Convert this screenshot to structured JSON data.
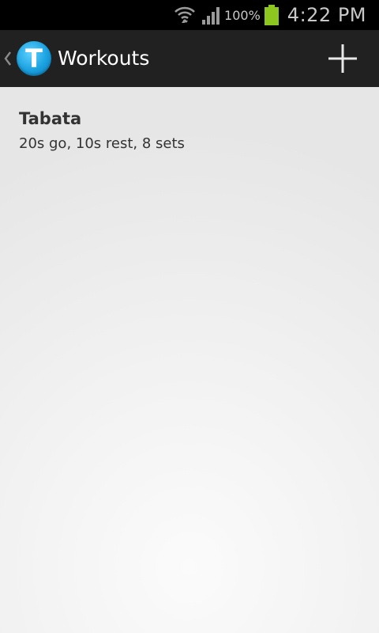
{
  "status_bar": {
    "wifi_icon": "wifi-icon",
    "signal_icon": "signal-icon",
    "battery_percent": "100%",
    "battery_icon": "battery-icon",
    "battery_color": "#8dc61e",
    "time": "4:22 PM"
  },
  "action_bar": {
    "back_icon": "chevron-left-icon",
    "logo_letter": "T",
    "title": "Workouts",
    "add_icon": "plus-icon"
  },
  "workouts": [
    {
      "name": "Tabata",
      "description": "20s go, 10s rest, 8 sets"
    }
  ],
  "colors": {
    "action_bar_bg": "#212121",
    "status_bar_bg": "#000000",
    "logo_blue": "#1aa1e0"
  }
}
